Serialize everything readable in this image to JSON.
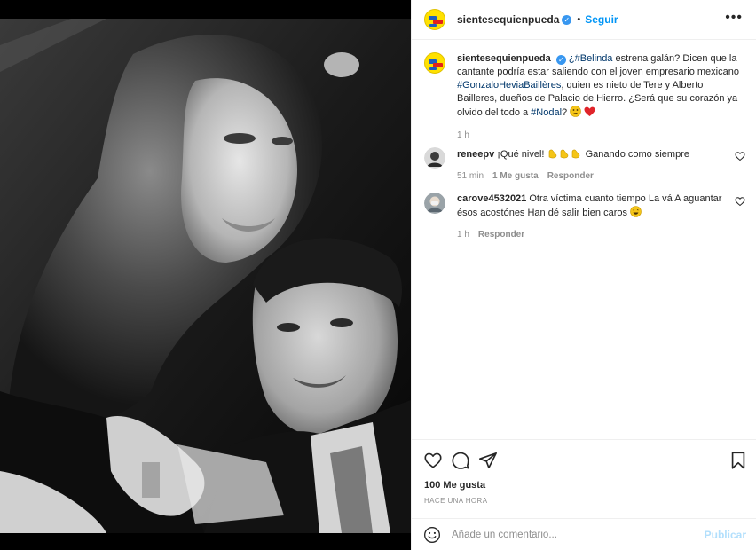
{
  "post": {
    "username": "sientesequienpueda",
    "verified_mark": "✓",
    "dot": "•",
    "follow_label": "Seguir",
    "more_label": "•••",
    "caption": {
      "tag1": "¿#Belinda",
      "text1": " estrena galán? Dicen que la cantante podría estar saliendo con el joven empresario mexicano ",
      "tag2": "#GonzaloHeviaBaillères",
      "text2": ", quien es nieto de Tere y Alberto Bailleres, dueños de Palacio de Hierro. ¿Será que su corazón ya olvido del todo a ",
      "tag3": "#Nodal",
      "text3": "? ",
      "time": "1 h"
    },
    "comments": [
      {
        "username": "reneepv",
        "text": "¡Qué nivel! ",
        "text_after": " Ganando como siempre",
        "time": "51 min",
        "likes": "1 Me gusta",
        "reply": "Responder"
      },
      {
        "username": "carove4532021",
        "text": "Otra víctima cuanto tiempo La vá A aguantar ésos acostónes Han dé salir bien caros ",
        "time": "1 h",
        "reply": "Responder"
      }
    ],
    "likes_count": "100 Me gusta",
    "timestamp": "HACE UNA HORA",
    "add_comment_placeholder": "Añade un comentario...",
    "publish_label": "Publicar"
  },
  "icons": {
    "like": "heart-icon",
    "comment": "comment-icon",
    "share": "paper-plane-icon",
    "save": "bookmark-icon",
    "emoji": "smiley-icon"
  },
  "colors": {
    "link": "#00376b",
    "follow": "#0095f6",
    "publish_disabled": "#b2dffc",
    "verified": "#3897f0"
  }
}
